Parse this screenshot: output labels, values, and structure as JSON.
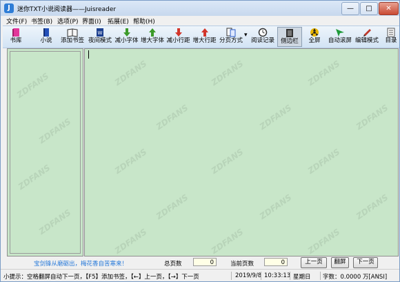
{
  "window": {
    "title": "迷你TXT小说阅读器——Juisreader",
    "minimize_glyph": "—",
    "maximize_glyph": "□",
    "close_glyph": "✕"
  },
  "menu": [
    "文件(F)",
    "书签(B)",
    "选项(P)",
    "界面(I)",
    "拓展(E)",
    "帮助(H)"
  ],
  "toolbar": [
    {
      "label": "书库",
      "icon": "library-book-icon",
      "color": "#e2379a"
    },
    {
      "label": "小说",
      "icon": "novel-book-icon",
      "color": "#2450b8"
    },
    {
      "label": "添加书签",
      "icon": "add-bookmark-icon",
      "color": "#303030"
    },
    {
      "label": "夜间模式",
      "icon": "night-mode-icon",
      "color": "#1c3f8f"
    },
    {
      "label": "减小字体",
      "icon": "font-decrease-icon",
      "color": "#3c9a2a"
    },
    {
      "label": "增大字体",
      "icon": "font-increase-icon",
      "color": "#3c9a2a"
    },
    {
      "label": "减小行距",
      "icon": "line-spacing-decrease-icon",
      "color": "#d2352a"
    },
    {
      "label": "增大行距",
      "icon": "line-spacing-increase-icon",
      "color": "#d2352a"
    },
    {
      "label": "分页方式",
      "icon": "pagination-mode-icon",
      "color": "#2a5cc5"
    },
    {
      "label": "阅读记录",
      "icon": "reading-history-clock-icon",
      "color": "#333333"
    },
    {
      "label": "侧边栏",
      "icon": "sidebar-toggle-icon",
      "color": "#333333"
    },
    {
      "label": "全屏",
      "icon": "fullscreen-icon",
      "color": "#e8b400"
    },
    {
      "label": "自动滚屏",
      "icon": "auto-scroll-icon",
      "color": "#1f9a3a"
    },
    {
      "label": "编辑模式",
      "icon": "edit-mode-pen-icon",
      "color": "#c0392b"
    },
    {
      "label": "目录",
      "icon": "table-of-contents-icon",
      "color": "#555555"
    }
  ],
  "toolbar_dropdown_glyph": "▾",
  "watermark": "ZDFANS",
  "reader": {
    "background": "#c8e6c9"
  },
  "navbar": {
    "quote": "宝剑锋从磨砺出，梅花香自苦寒来！",
    "total_pages_label": "总页数",
    "total_pages_value": "0",
    "current_page_label": "当前页数",
    "current_page_value": "0",
    "prev_button": "上一页",
    "page_button": "翻屏",
    "next_button": "下一页"
  },
  "status": {
    "hint": "小提示：空格翻屏自动下一页，【F5】添加书签，【←】上一页，【→】下一页",
    "date": "2019/9/8",
    "time": "10:33:13",
    "weekday": "星期日",
    "chars": "字数：0.0000 万[ANSI]"
  }
}
